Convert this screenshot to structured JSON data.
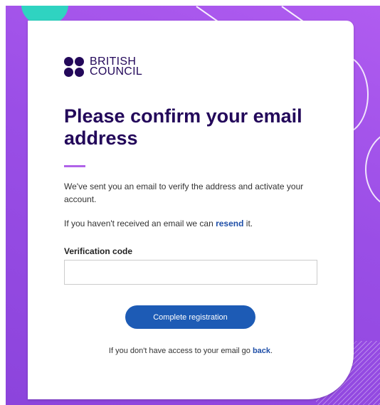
{
  "brand": {
    "line1": "BRITISH",
    "line2": "COUNCIL"
  },
  "title": "Please confirm your email address",
  "intro": "We've sent you an email to verify the address and activate your account.",
  "resend": {
    "prefix": "If you haven't received an email we can ",
    "link": "resend",
    "suffix": " it."
  },
  "verification": {
    "label": "Verification code",
    "value": "",
    "placeholder": ""
  },
  "submit_label": "Complete registration",
  "footer": {
    "prefix": "If you don't have access to your email go ",
    "link": "back",
    "suffix": "."
  },
  "colors": {
    "brand_navy": "#23085a",
    "button_blue": "#1d5bb5",
    "link_blue": "#1f4fa8",
    "accent_purple": "#b063e8",
    "background_purple": "#9a4ee6"
  }
}
